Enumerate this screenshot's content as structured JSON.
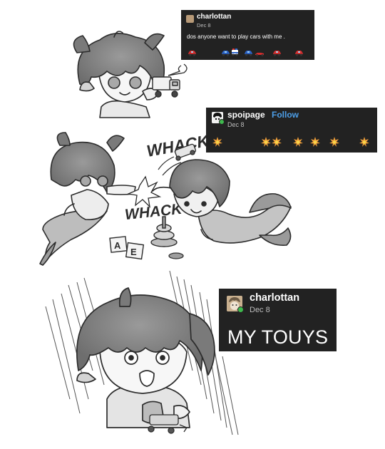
{
  "posts": [
    {
      "username": "charlottan",
      "date": "Dec 8",
      "text": "dos anyone want to play cars with me .",
      "emoji_row": [
        "red-car",
        "blue-car",
        "police-car",
        "blue-car",
        "racing-car",
        "red-car",
        "red-car"
      ]
    },
    {
      "username": "spoipage",
      "follow_label": "Follow",
      "date": "Dec 8",
      "emoji_row": [
        "collision",
        "collision",
        "collision",
        "collision",
        "collision",
        "collision",
        "collision"
      ]
    },
    {
      "username": "charlottan",
      "date": "Dec 8",
      "text": "MY TOUYS"
    }
  ],
  "comic": {
    "sound_effects": [
      "WHACK",
      "WHACK"
    ],
    "blocks": [
      "A",
      "E"
    ]
  },
  "colors": {
    "card_bg": "#222222",
    "card_text": "#ffffff",
    "follow": "#4d9fe8",
    "reblog": "#3fb94e"
  }
}
